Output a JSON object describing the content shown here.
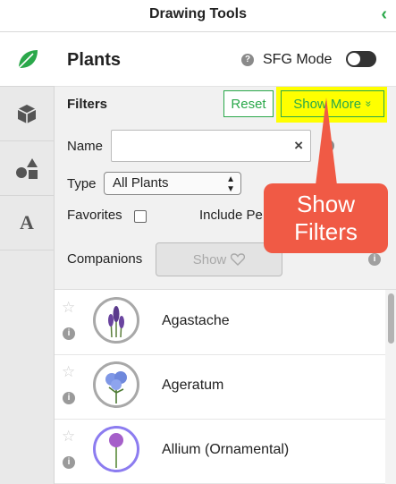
{
  "app": {
    "title": "Drawing Tools",
    "collapse_icon": "‹"
  },
  "sidebar": {
    "items": [
      {
        "name": "leaf-icon",
        "label": "Plants"
      },
      {
        "name": "cube-icon",
        "label": "Objects"
      },
      {
        "name": "shapes-icon",
        "label": "Shapes"
      },
      {
        "name": "text-icon",
        "label": "A"
      }
    ]
  },
  "panel": {
    "title": "Plants",
    "sfg_label": "SFG Mode",
    "help": "?"
  },
  "filters": {
    "title": "Filters",
    "reset_label": "Reset",
    "show_more_label": "Show More",
    "show_more_chevron": "»",
    "name_label": "Name",
    "name_value": "",
    "clear_icon": "×",
    "help": "?",
    "type_label": "Type",
    "type_value": "All Plants",
    "favorites_label": "Favorites",
    "include_label": "Include Pe",
    "companions_label": "Companions",
    "companions_button": "Show",
    "info": "i"
  },
  "callout": {
    "line1": "Show",
    "line2": "Filters"
  },
  "plants": [
    {
      "name": "Agastache",
      "star": "☆",
      "info": "i"
    },
    {
      "name": "Ageratum",
      "star": "☆",
      "info": "i"
    },
    {
      "name": "Allium (Ornamental)",
      "star": "☆",
      "info": "i"
    }
  ],
  "colors": {
    "accent": "#2aa84a",
    "highlight": "#ffff00",
    "callout": "#f05a45"
  }
}
